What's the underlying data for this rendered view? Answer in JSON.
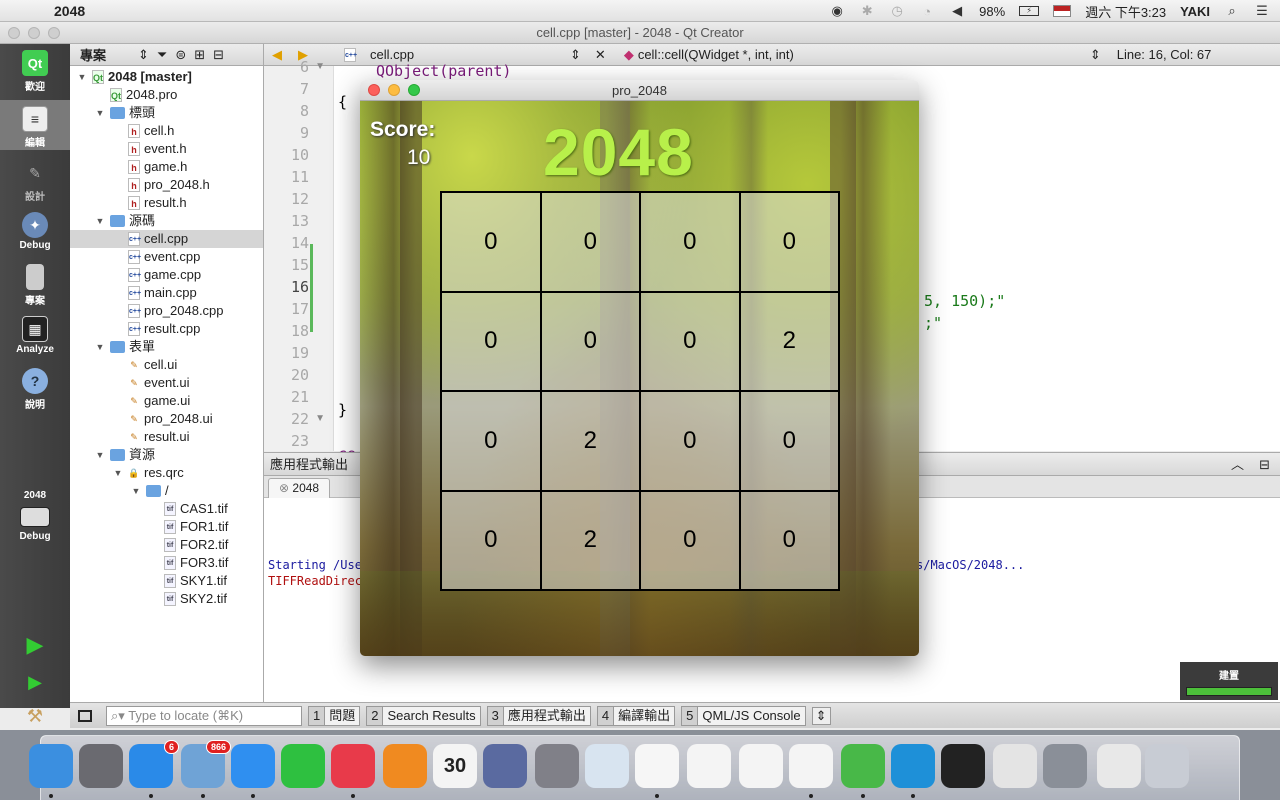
{
  "menubar": {
    "app_name": "2048",
    "battery": "98%",
    "datetime": "週六 下午3:23",
    "user": "YAKI"
  },
  "qt_window": {
    "title": "cell.cpp [master] - 2048 - Qt Creator"
  },
  "modes": [
    {
      "label": "歡迎",
      "icon": "qt-logo-icon"
    },
    {
      "label": "編輯",
      "icon": "edit-icon"
    },
    {
      "label": "設計",
      "icon": "design-icon"
    },
    {
      "label": "Debug",
      "icon": "debug-icon"
    },
    {
      "label": "專案",
      "icon": "project-icon"
    },
    {
      "label": "Analyze",
      "icon": "analyze-icon"
    },
    {
      "label": "說明",
      "icon": "help-icon"
    }
  ],
  "target": {
    "project": "2048",
    "build": "Debug"
  },
  "project_pane": {
    "header": "專案",
    "tree": [
      {
        "label": "2048 [master]",
        "level": 0,
        "type": "pro",
        "expanded": true
      },
      {
        "label": "2048.pro",
        "level": 1,
        "type": "pro"
      },
      {
        "label": "標頭",
        "level": 1,
        "type": "folder-h",
        "expanded": true
      },
      {
        "label": "cell.h",
        "level": 2,
        "type": "h"
      },
      {
        "label": "event.h",
        "level": 2,
        "type": "h"
      },
      {
        "label": "game.h",
        "level": 2,
        "type": "h"
      },
      {
        "label": "pro_2048.h",
        "level": 2,
        "type": "h"
      },
      {
        "label": "result.h",
        "level": 2,
        "type": "h"
      },
      {
        "label": "源碼",
        "level": 1,
        "type": "folder-cpp",
        "expanded": true
      },
      {
        "label": "cell.cpp",
        "level": 2,
        "type": "cpp",
        "selected": true
      },
      {
        "label": "event.cpp",
        "level": 2,
        "type": "cpp"
      },
      {
        "label": "game.cpp",
        "level": 2,
        "type": "cpp"
      },
      {
        "label": "main.cpp",
        "level": 2,
        "type": "cpp"
      },
      {
        "label": "pro_2048.cpp",
        "level": 2,
        "type": "cpp"
      },
      {
        "label": "result.cpp",
        "level": 2,
        "type": "cpp"
      },
      {
        "label": "表單",
        "level": 1,
        "type": "folder-ui",
        "expanded": true
      },
      {
        "label": "cell.ui",
        "level": 2,
        "type": "ui"
      },
      {
        "label": "event.ui",
        "level": 2,
        "type": "ui"
      },
      {
        "label": "game.ui",
        "level": 2,
        "type": "ui"
      },
      {
        "label": "pro_2048.ui",
        "level": 2,
        "type": "ui"
      },
      {
        "label": "result.ui",
        "level": 2,
        "type": "ui"
      },
      {
        "label": "資源",
        "level": 1,
        "type": "folder-res",
        "expanded": true
      },
      {
        "label": "res.qrc",
        "level": 2,
        "type": "qrc",
        "expanded": true
      },
      {
        "label": "/",
        "level": 3,
        "type": "folder",
        "expanded": true
      },
      {
        "label": "CAS1.tif",
        "level": 4,
        "type": "tif"
      },
      {
        "label": "FOR1.tif",
        "level": 4,
        "type": "tif"
      },
      {
        "label": "FOR2.tif",
        "level": 4,
        "type": "tif"
      },
      {
        "label": "FOR3.tif",
        "level": 4,
        "type": "tif"
      },
      {
        "label": "SKY1.tif",
        "level": 4,
        "type": "tif"
      },
      {
        "label": "SKY2.tif",
        "level": 4,
        "type": "tif"
      }
    ]
  },
  "editor": {
    "file": "cell.cpp",
    "symbol": "cell::cell(QWidget *, int, int)",
    "position": "Line: 16, Col: 67",
    "line_numbers": [
      "6",
      "7",
      "8",
      "9",
      "10",
      "11",
      "12",
      "13",
      "14",
      "15",
      "16",
      "17",
      "18",
      "19",
      "20",
      "21",
      "22",
      "23"
    ],
    "current_line": "16",
    "visible_code": [
      {
        "line": "6",
        "text": "QObject(parent)"
      },
      {
        "line": "7",
        "text": "{"
      },
      {
        "line": "16",
        "text": "5, 150);\""
      },
      {
        "line": "17",
        "text": ";\""
      },
      {
        "line": "20",
        "text": "}"
      },
      {
        "line": "22",
        "text": "ce"
      },
      {
        "line": "23",
        "text": "{"
      }
    ]
  },
  "output": {
    "header": "應用程式輸出",
    "tab": "2048",
    "lines": [
      {
        "text": "Starting /Use",
        "color": "#1a1aa0"
      },
      {
        "text": "TIFFReadDirec",
        "color": "#b01010"
      }
    ],
    "line_tail": "s/MacOS/2048..."
  },
  "statusbar": {
    "locate_placeholder": "Type to locate (⌘K)",
    "tabs": [
      {
        "num": "1",
        "label": "問題"
      },
      {
        "num": "2",
        "label": "Search Results"
      },
      {
        "num": "3",
        "label": "應用程式輸出"
      },
      {
        "num": "4",
        "label": "編譯輸出"
      },
      {
        "num": "5",
        "label": "QML/JS Console"
      }
    ]
  },
  "build": {
    "label": "建置",
    "progress": 1.0
  },
  "game": {
    "window_title": "pro_2048",
    "score_label": "Score:",
    "score_value": "10",
    "logo": "2048",
    "grid": [
      [
        "0",
        "0",
        "0",
        "0"
      ],
      [
        "0",
        "0",
        "0",
        "2"
      ],
      [
        "0",
        "2",
        "0",
        "0"
      ],
      [
        "0",
        "2",
        "0",
        "0"
      ]
    ]
  },
  "dock": {
    "apps": [
      {
        "name": "finder-icon",
        "color": "#3b8fe0"
      },
      {
        "name": "launchpad-icon",
        "color": "#6a6a70"
      },
      {
        "name": "app-store-icon",
        "color": "#2a8ae8",
        "badge": "6"
      },
      {
        "name": "mail-icon",
        "color": "#6fa3d6",
        "badge": "866"
      },
      {
        "name": "safari-icon",
        "color": "#2f8ff0"
      },
      {
        "name": "facetime-icon",
        "color": "#2ec040"
      },
      {
        "name": "itunes-icon",
        "color": "#e83a4a"
      },
      {
        "name": "ibooks-icon",
        "color": "#f08a20"
      },
      {
        "name": "calendar-icon",
        "color": "#f4f4f4",
        "label": "30"
      },
      {
        "name": "xcode-instruments-icon",
        "color": "#5a6aa0"
      },
      {
        "name": "system-preferences-icon",
        "color": "#808088"
      },
      {
        "name": "preview-icon",
        "color": "#d8e4f0"
      },
      {
        "name": "photos-icon",
        "color": "#f6f6f6"
      },
      {
        "name": "acrobat-icon",
        "color": "#f4f4f4"
      },
      {
        "name": "powerpoint-icon",
        "color": "#f4f4f4"
      },
      {
        "name": "matlab-icon",
        "color": "#f4f4f4"
      },
      {
        "name": "qt-creator-icon",
        "color": "#48b848"
      },
      {
        "name": "swift-express-icon",
        "color": "#1e90d8"
      },
      {
        "name": "terminal-icon",
        "color": "#222"
      },
      {
        "name": "archive-utility-icon",
        "color": "#e4e4e4"
      },
      {
        "name": "help-icon",
        "color": "#8a8f98"
      },
      {
        "name": "documents-icon",
        "color": "#e8e8e8"
      },
      {
        "name": "trash-icon",
        "color": "#c8ccd4"
      }
    ]
  }
}
